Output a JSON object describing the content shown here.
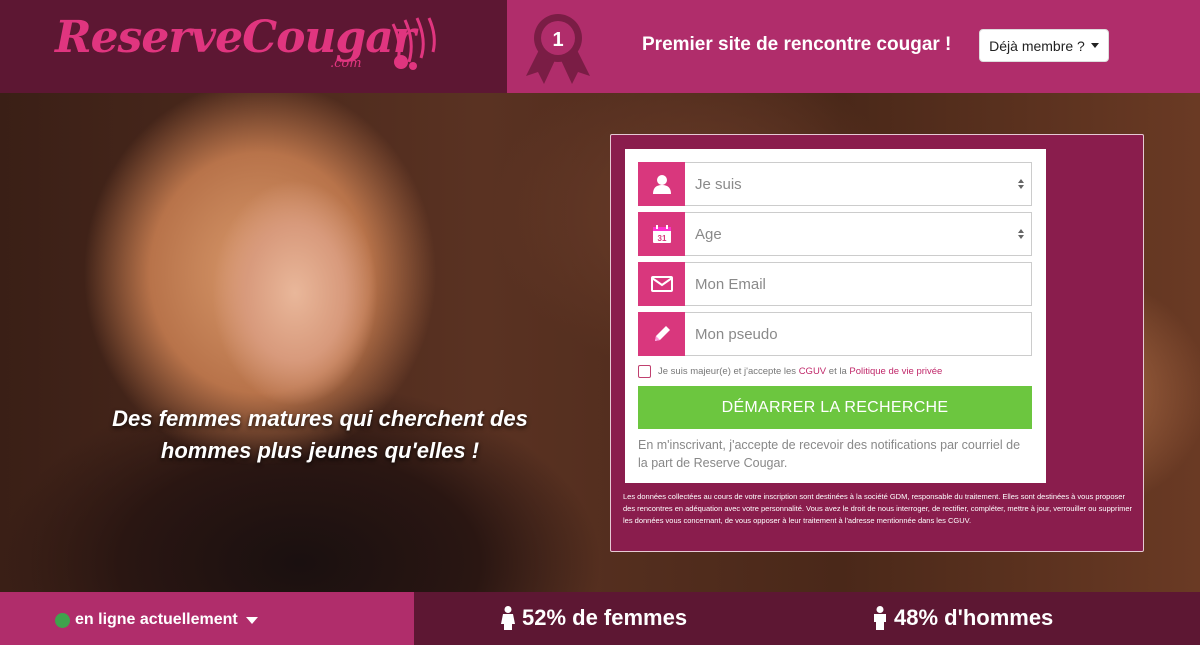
{
  "header": {
    "logo_text": "ReserveCougar",
    "logo_suffix": ".com",
    "badge_number": "1",
    "tagline": "Premier site de rencontre cougar !",
    "member_button": "Déjà membre ?"
  },
  "hero": {
    "line1": "Des femmes matures qui cherchent des",
    "line2": "hommes plus jeunes qu'elles !"
  },
  "form": {
    "gender_placeholder": "Je suis",
    "age_placeholder": "Age",
    "email_placeholder": "Mon Email",
    "pseudo_placeholder": "Mon pseudo",
    "consent_prefix": "Je suis majeur(e) et j'accepte les",
    "consent_link1": "CGUV",
    "consent_middle": "et la",
    "consent_link2": "Politique de vie privée",
    "submit": "DÉMARRER LA RECHERCHE",
    "notification": "En m'inscrivant, j'accepte de recevoir des notifications par courriel de la part de Reserve Cougar.",
    "legal": "Les données collectées au cours de votre inscription sont destinées à la société GDM, responsable du traitement. Elles sont destinées à vous proposer des rencontres en adéquation avec votre personnalité. Vous avez le droit de nous interroger, de rectifier, compléter, mettre à jour, verrouiller ou supprimer les données vous concernant, de vous opposer à leur traitement à l'adresse mentionnée dans les CGUV."
  },
  "footer": {
    "online": "en ligne actuellement",
    "women": "52% de femmes",
    "men": "48% d'hommes"
  },
  "colors": {
    "brand_pink": "#d9377d",
    "dark_plum": "#5d1733",
    "magenta": "#b02d6b",
    "cta_green": "#6cc63f"
  }
}
